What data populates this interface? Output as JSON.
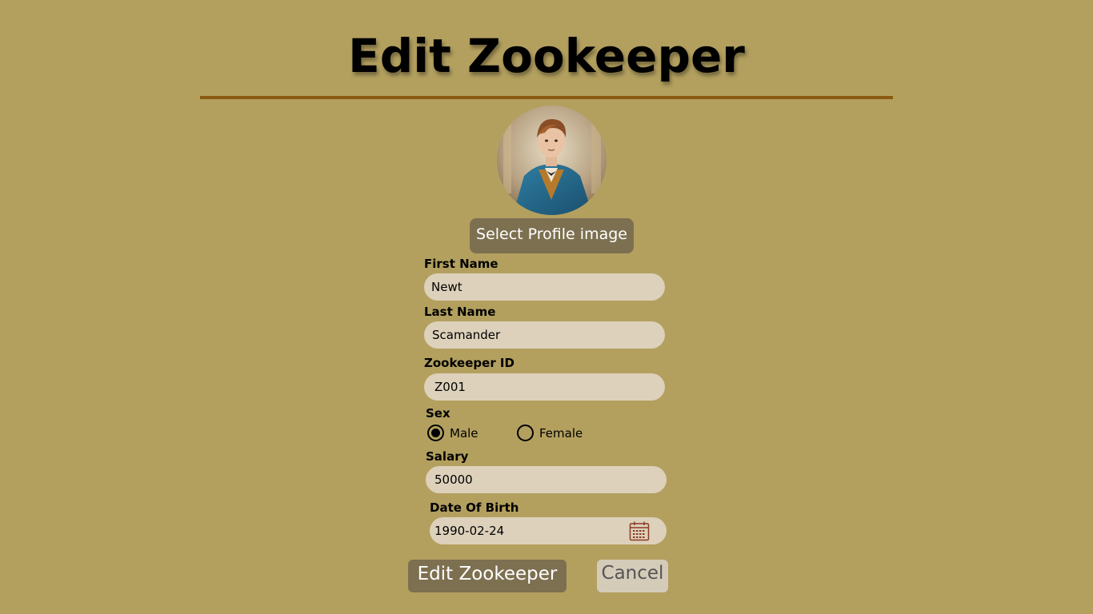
{
  "page": {
    "title": "Edit Zookeeper"
  },
  "profile": {
    "select_image_label": "Select Profile image"
  },
  "form": {
    "first_name": {
      "label": "First Name",
      "value": "Newt"
    },
    "last_name": {
      "label": "Last Name",
      "value": "Scamander"
    },
    "zookeeper_id": {
      "label": "Zookeeper ID",
      "value": "Z001"
    },
    "sex": {
      "label": "Sex",
      "options": [
        "Male",
        "Female"
      ],
      "selected": "Male"
    },
    "salary": {
      "label": "Salary",
      "value": "50000"
    },
    "date_of_birth": {
      "label": "Date Of Birth",
      "value": "1990-02-24"
    }
  },
  "actions": {
    "submit_label": "Edit Zookeeper",
    "cancel_label": "Cancel"
  },
  "colors": {
    "background": "#b3a05f",
    "divider": "#8b5a12",
    "button": "#7d7050",
    "input": "#ddd1bb",
    "cancel": "#d4cbb9"
  },
  "icons": [
    "calendar-icon"
  ]
}
